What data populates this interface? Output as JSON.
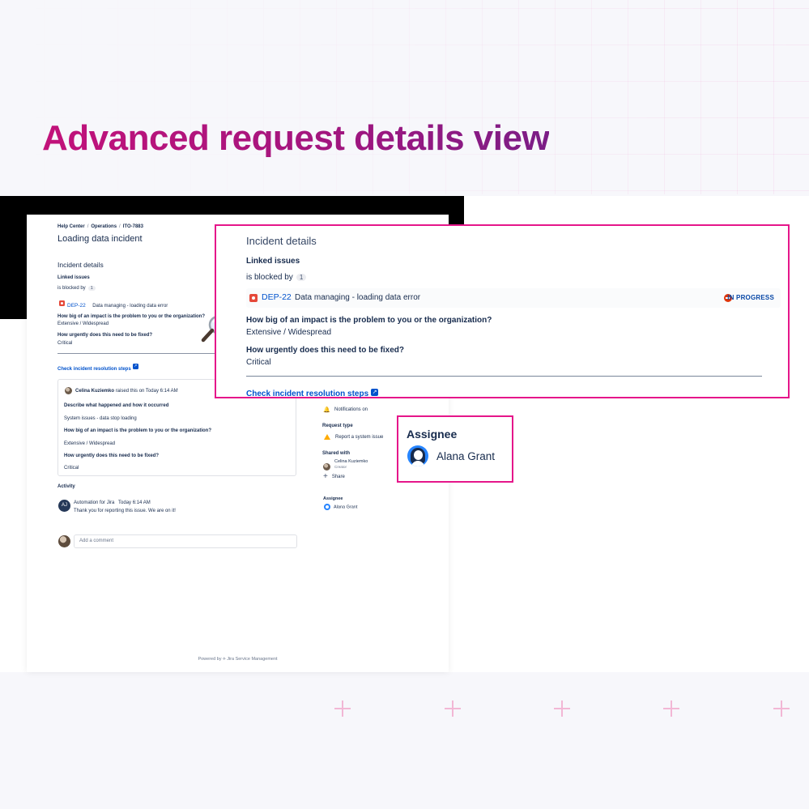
{
  "hero": {
    "title": "Advanced request details view"
  },
  "portal": {
    "breadcrumbs": [
      "Help Center",
      "Operations",
      "ITO-7883"
    ],
    "page_title": "Loading data incident",
    "section_title": "Incident details",
    "linked_issues_label": "Linked issues",
    "blocked_by_label": "is blocked by",
    "blocked_by_count": "1",
    "issue_key": "DEP-22",
    "issue_summary": "Data managing - loading data error",
    "q_impact": "How big of an impact is the problem to you or the organization?",
    "a_impact": "Extensive / Widespread",
    "q_urgency": "How urgently does this need to be fixed?",
    "a_urgency": "Critical",
    "resolution_link": "Check incident resolution steps",
    "request": {
      "reporter": "Celina Kuziemko",
      "raised_text": "raised this on Today 6:14 AM",
      "q_describe": "Describe what happened and how it occurred",
      "a_describe": "System issues - data stop loading",
      "q_impact": "How big of an impact is the problem to you or the organization?",
      "a_impact": "Extensive / Widespread",
      "q_urgency": "How urgently does this need to be fixed?",
      "a_urgency": "Critical"
    },
    "activity": {
      "title": "Activity",
      "author": "Automation for Jira",
      "time": "Today 6:14 AM",
      "message": "Thank you for reporting this issue. We are on it!",
      "author_initials": "AJ"
    },
    "comment_placeholder": "Add a comment",
    "sidebar": {
      "notifications": "Notifications on",
      "request_type_label": "Request type",
      "request_type_value": "Report a system issue",
      "shared_with_label": "Shared with",
      "shared_user": "Celina Kuziemko",
      "shared_role": "Creator",
      "share_label": "Share",
      "assignee_label": "Assignee",
      "assignee_name": "Alana Grant"
    },
    "powered_by": "Powered by",
    "powered_product": "Jira Service Management"
  },
  "zoom": {
    "title": "Incident details",
    "linked_issues_label": "Linked issues",
    "blocked_by_label": "is blocked by",
    "blocked_by_count": "1",
    "issue_key": "DEP-22",
    "issue_summary": "Data managing - loading data error",
    "status": "IN PROGRESS",
    "q_impact": "How big of an impact is the problem to you or the organization?",
    "a_impact": "Extensive / Widespread",
    "q_urgency": "How urgently does this need to be fixed?",
    "a_urgency": "Critical",
    "resolution_link": "Check incident resolution steps"
  },
  "assignee_callout": {
    "title": "Assignee",
    "name": "Alana Grant"
  },
  "colors": {
    "accent": "#e5168a",
    "link": "#0052cc",
    "title_gradient_start": "#c2127a",
    "title_gradient_end": "#7b1d86"
  },
  "icons": [
    "issue-type-icon",
    "external-link-icon",
    "magnifier-icon",
    "bell-icon",
    "warning-icon",
    "plus-icon",
    "avatar-icon",
    "status-blocked-icon",
    "jira-logo-icon"
  ]
}
